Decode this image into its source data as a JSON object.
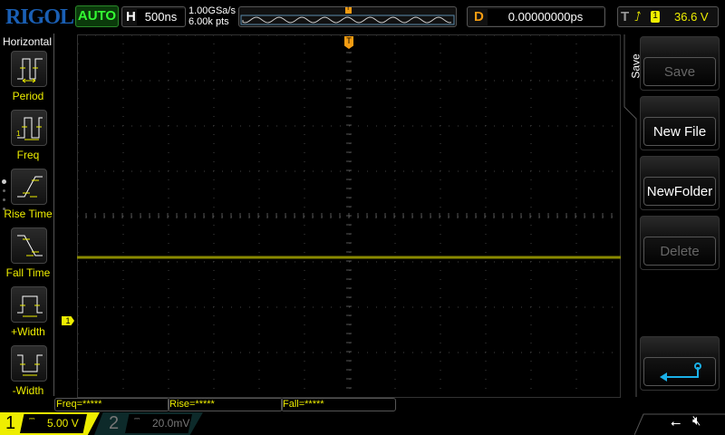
{
  "header": {
    "logo": "RIGOL",
    "mode": "AUTO",
    "h_label": "H",
    "timebase": "500ns",
    "sample_rate": "1.00GSa/s",
    "memory_depth": "6.00k pts",
    "trigger_marker": "T",
    "d_label": "D",
    "delay": "0.00000000ps",
    "t_label": "T",
    "trigger_channel": "1",
    "trigger_level": "36.6 V",
    "trigger_slope_icon": "rising-edge-icon"
  },
  "sidebar": {
    "title": "Horizontal",
    "items": [
      {
        "label": "Period",
        "icon": "period-icon"
      },
      {
        "label": "Freq",
        "icon": "freq-icon"
      },
      {
        "label": "Rise Time",
        "icon": "rise-time-icon"
      },
      {
        "label": "Fall Time",
        "icon": "fall-time-icon"
      },
      {
        "label": "+Width",
        "icon": "positive-width-icon"
      },
      {
        "label": "-Width",
        "icon": "negative-width-icon"
      }
    ]
  },
  "grid": {
    "h_divisions": 12,
    "v_divisions": 8,
    "trace_color": "#8a8a00",
    "trace_level_div": -0.92,
    "ch1_marker": "1"
  },
  "menu": {
    "title": "Save",
    "buttons": [
      {
        "label": "Save",
        "enabled": false
      },
      {
        "label": "New File",
        "enabled": true
      },
      {
        "label": "NewFolder",
        "enabled": true
      },
      {
        "label": "Delete",
        "enabled": false
      }
    ],
    "back_icon": "return-arrow-icon"
  },
  "measurements": [
    "Freq=*****",
    "Rise=*****",
    "Fall=*****"
  ],
  "channels": [
    {
      "num": "1",
      "scale": "5.00 V",
      "coupling": "DC",
      "color": "#eeee00"
    },
    {
      "num": "2",
      "scale": "20.0mV",
      "coupling": "DC",
      "color": "#4a7a7a"
    }
  ],
  "status": {
    "usb_icon": "usb-icon",
    "sound_icon": "speaker-muted-icon"
  }
}
